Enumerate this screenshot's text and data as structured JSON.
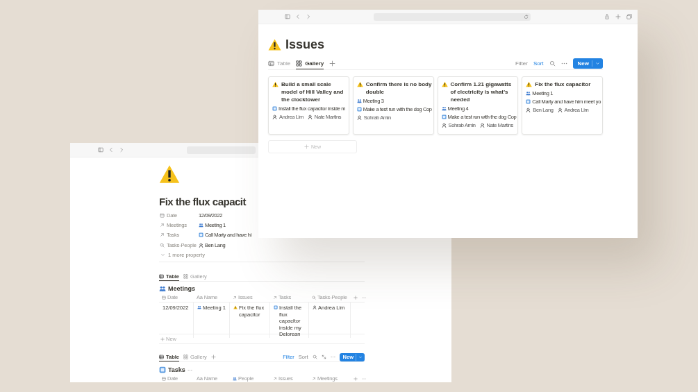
{
  "back_window": {
    "title": "Fix the flux capacit",
    "properties": [
      {
        "label": "Date",
        "value": "12/09/2022",
        "kind": "date"
      },
      {
        "label": "Meetings",
        "value": "Meeting 1",
        "kind": "meeting"
      },
      {
        "label": "Tasks",
        "value": "Call Marty and have hi",
        "kind": "task"
      },
      {
        "label": "Tasks-People",
        "value": "Ben Lang",
        "kind": "person"
      }
    ],
    "more_properties": "1 more property",
    "meetings_db": {
      "views": [
        {
          "label": "Table",
          "selected": true
        },
        {
          "label": "Gallery",
          "selected": false
        }
      ],
      "title": "Meetings",
      "columns": [
        {
          "label": "Date",
          "kind": "date"
        },
        {
          "label": "Name",
          "kind": "title",
          "glyph": "Aa"
        },
        {
          "label": "Issues",
          "kind": "issue"
        },
        {
          "label": "Tasks",
          "kind": "task"
        },
        {
          "label": "Tasks-People",
          "kind": "person"
        }
      ],
      "rows": [
        {
          "cells": [
            "12/09/2022",
            "Meeting 1",
            "Fix the flux capacitor",
            "Install the flux capacitor inside my Delorean",
            "Andrea Lim"
          ]
        }
      ],
      "new_row": "New"
    },
    "tasks_db": {
      "views": [
        {
          "label": "Table",
          "selected": true
        },
        {
          "label": "Gallery",
          "selected": false
        }
      ],
      "actions": [
        {
          "label": "Filter",
          "active": true
        },
        {
          "label": "Sort",
          "active": false
        }
      ],
      "new_button": "New",
      "title": "Tasks",
      "columns": [
        {
          "label": "Date",
          "kind": "date"
        },
        {
          "label": "Name",
          "kind": "title",
          "glyph": "Aa"
        },
        {
          "label": "People",
          "kind": "people"
        },
        {
          "label": "Issues",
          "kind": "issue"
        },
        {
          "label": "Meetings",
          "kind": "meeting"
        }
      ]
    }
  },
  "front_window": {
    "title": "Issues",
    "views": [
      {
        "label": "Table",
        "selected": false
      },
      {
        "label": "Gallery",
        "selected": true
      }
    ],
    "actions": [
      {
        "label": "Filter",
        "active": false
      },
      {
        "label": "Sort",
        "active": true
      }
    ],
    "new_button": "New",
    "cards": [
      {
        "title": "Build a small scale model of Hill Valley and the clocktower",
        "tasks": [
          "Install the flux capacitor inside m"
        ],
        "people": [
          "Andrea Lim",
          "Nate Martins"
        ]
      },
      {
        "title": "Confirm there is no body double",
        "meetings": [
          "Meeting 3"
        ],
        "tasks": [
          "Make a test run with the dog Cop"
        ],
        "people": [
          "Sohrab Amin"
        ]
      },
      {
        "title": "Confirm 1.21 gigawatts of electricity is what’s needed",
        "meetings": [
          "Meeting 4"
        ],
        "tasks": [
          "Make a test run with the dog Cop"
        ],
        "people": [
          "Sohrab Amin",
          "Nate Martins"
        ]
      },
      {
        "title": "Fix the flux capacitor",
        "meetings": [
          "Meeting 1"
        ],
        "tasks": [
          "Call Marty and have him meet yo"
        ],
        "people": [
          "Ben Lang",
          "Andrea Lim"
        ]
      }
    ],
    "new_card": "New"
  }
}
